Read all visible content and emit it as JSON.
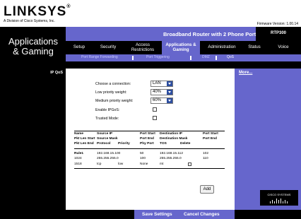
{
  "brand": {
    "logo": "LINKSYS",
    "reg": "®",
    "subtitle": "A Division of Cisco Systems, Inc.",
    "firmware": "Firmware Version: 1.00.14"
  },
  "header": {
    "section_title_1": "Applications",
    "section_title_2": "& Gaming",
    "product": "Broadband Router with 2 Phone Ports",
    "model": "RTP300"
  },
  "tabs": [
    {
      "label": "Setup"
    },
    {
      "label": "Security"
    },
    {
      "label": "Access Restrictions"
    },
    {
      "label": "Applications & Gaming",
      "active": true
    },
    {
      "label": "Administration"
    },
    {
      "label": "Status"
    },
    {
      "label": "Voice"
    }
  ],
  "subtabs": [
    {
      "label": "Port Range Forwarding"
    },
    {
      "label": "Port Triggering"
    },
    {
      "label": "DMZ"
    },
    {
      "label": "QoS",
      "active": true
    }
  ],
  "left_label": "IP QoS",
  "more_link": "More...",
  "form": {
    "connection_label": "Choose a connection:",
    "connection_value": "LAN",
    "low_label": "Low priority weight:",
    "low_value": "40%",
    "medium_label": "Medium priority weight:",
    "medium_value": "60%",
    "ipgos_label": "Enable IPGoS:",
    "trusted_label": "Trusted Mode:"
  },
  "table": {
    "headers": {
      "name": "Name",
      "source_ip": "Source IP",
      "port_start": "Port Start",
      "dest_ip": "Destination IP",
      "port_start2": "Port Start",
      "pkt_len_start": "Pkt Len Start",
      "source_mask": "Source Mask",
      "port_end": "Port End",
      "dest_mask": "Destination Mask",
      "port_end2": "Port End",
      "pkt_len_end": "Pkt Len End",
      "protocol": "Protocol",
      "priority": "Priority",
      "phy_port": "Phy Port",
      "tos": "TOS",
      "delete": "Delete"
    },
    "row": {
      "name": "Rule1",
      "source_ip": "192.168.15.100",
      "port_start": "50",
      "dest_ip": "192.168.15.112",
      "port_start2": "102",
      "pkt_len_start": "1024",
      "source_mask": "255.255.255.0",
      "port_end": "100",
      "dest_mask": "255.255.255.0",
      "port_end2": "110",
      "pkt_len_end": "1518",
      "protocol": "tcp",
      "priority": "low",
      "phy_port": "None",
      "tos": "mt"
    }
  },
  "add_label": "Add",
  "footer": {
    "save": "Save Settings",
    "cancel": "Cancel Changes"
  },
  "cisco": "CISCO SYSTEMS",
  "colors": {
    "accent": "#6666cc",
    "black": "#000000"
  }
}
